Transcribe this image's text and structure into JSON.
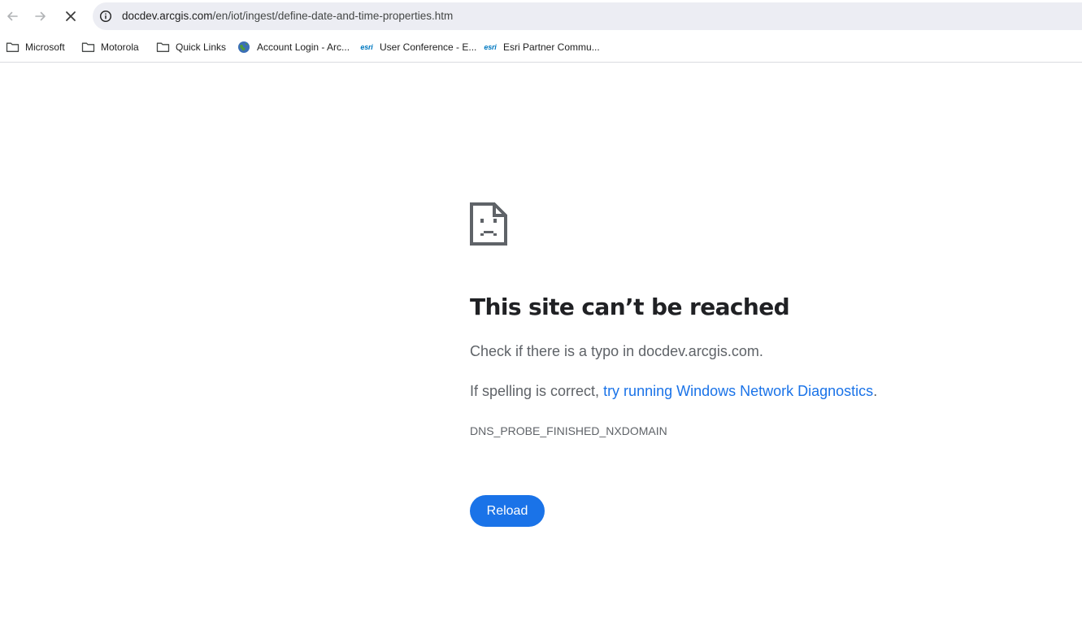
{
  "browser": {
    "url_host": "docdev.arcgis.com",
    "url_path": "/en/iot/ingest/define-date-and-time-properties.htm",
    "icons": {
      "back": "arrow-left-icon",
      "forward": "arrow-right-icon",
      "stop": "close-icon",
      "site_info": "info-icon"
    }
  },
  "bookmarks": [
    {
      "label": "Microsoft",
      "icon": "folder-icon"
    },
    {
      "label": "Motorola",
      "icon": "folder-icon"
    },
    {
      "label": "Quick Links",
      "icon": "folder-icon"
    },
    {
      "label": "Account Login - Arc...",
      "icon": "globe-icon"
    },
    {
      "label": "User Conference - E...",
      "icon": "esri-logo",
      "logo_text": "esri"
    },
    {
      "label": "Esri Partner Commu...",
      "icon": "esri-logo",
      "logo_text": "esri"
    }
  ],
  "error_page": {
    "title": "This site can’t be reached",
    "check_text": "Check if there is a typo in docdev.arcgis.com.",
    "spelling_prefix": "If spelling is correct, ",
    "diagnostics_link": "try running Windows Network Diagnostics",
    "spelling_suffix": ".",
    "error_code": "DNS_PROBE_FINISHED_NXDOMAIN",
    "reload_label": "Reload",
    "colors": {
      "accent": "#1a73e8",
      "text": "#202124",
      "secondary_text": "#5f6368"
    }
  }
}
